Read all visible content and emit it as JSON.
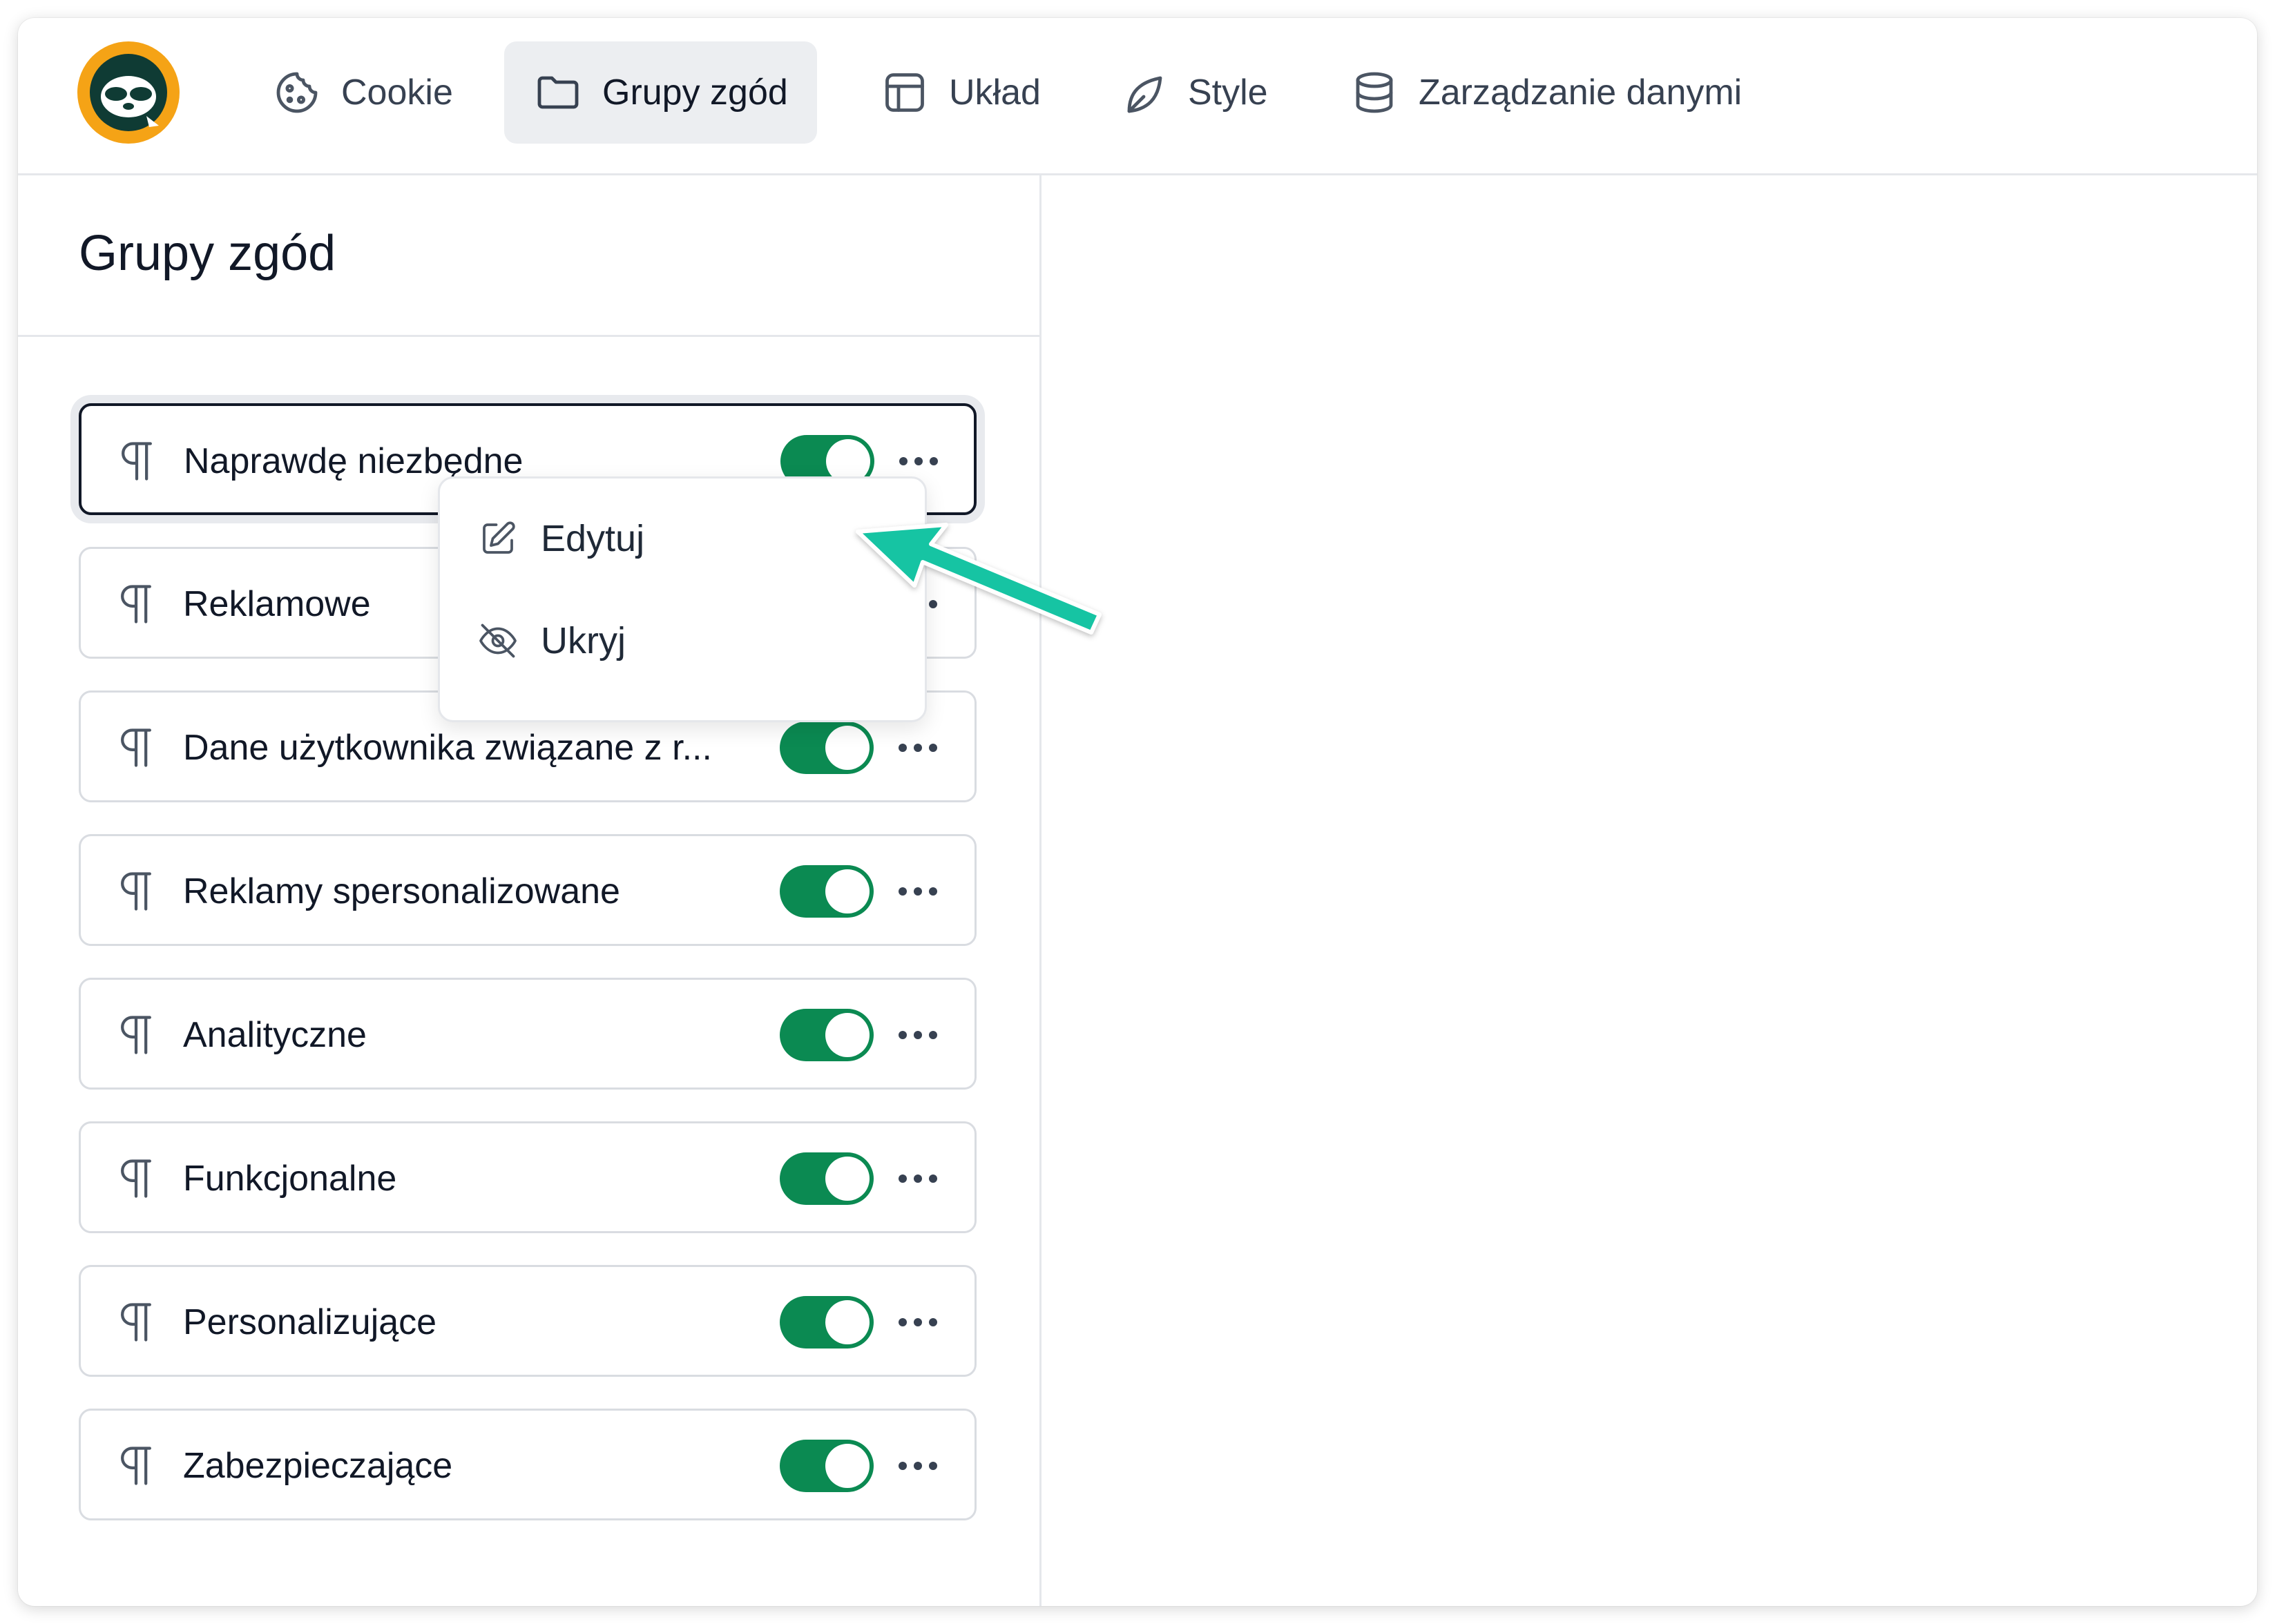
{
  "nav": {
    "items": [
      {
        "label": "Cookie",
        "icon": "cookie-icon",
        "active": false
      },
      {
        "label": "Grupy zgód",
        "icon": "folder-icon",
        "active": true
      },
      {
        "label": "Układ",
        "icon": "layout-icon",
        "active": false
      },
      {
        "label": "Style",
        "icon": "leaf-icon",
        "active": false
      },
      {
        "label": "Zarządzanie danymi",
        "icon": "database-icon",
        "active": false
      }
    ]
  },
  "panel": {
    "title": "Grupy zgód",
    "groups": [
      {
        "label": "Naprawdę niezbędne",
        "enabled": true,
        "selected": true
      },
      {
        "label": "Reklamowe",
        "enabled": true,
        "selected": false
      },
      {
        "label": "Dane użytkownika związane z r...",
        "enabled": true,
        "selected": false
      },
      {
        "label": "Reklamy spersonalizowane",
        "enabled": true,
        "selected": false
      },
      {
        "label": "Analityczne",
        "enabled": true,
        "selected": false
      },
      {
        "label": "Funkcjonalne",
        "enabled": true,
        "selected": false
      },
      {
        "label": "Personalizujące",
        "enabled": true,
        "selected": false
      },
      {
        "label": "Zabezpieczające",
        "enabled": true,
        "selected": false
      }
    ]
  },
  "menu": {
    "edit_label": "Edytuj",
    "hide_label": "Ukryj"
  },
  "colors": {
    "toggle_on": "#0b8a52",
    "logo_bg": "#f5a316",
    "logo_dark": "#0f3b34",
    "annotation_arrow": "#13c4a3"
  }
}
